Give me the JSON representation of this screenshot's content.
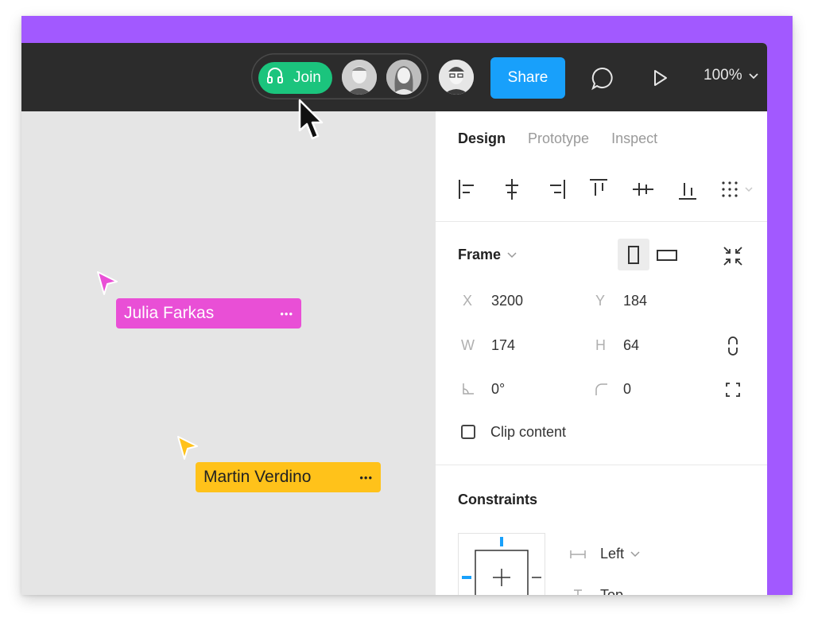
{
  "topbar": {
    "join_label": "Join",
    "share_label": "Share",
    "zoom_label": "100%",
    "icons": [
      "headphones-icon",
      "comment-icon",
      "play-icon",
      "chevron-down-icon"
    ]
  },
  "collaborators": [
    {
      "name": "Julia Farkas",
      "color": "#e94fd6",
      "text_color": "#ffffff"
    },
    {
      "name": "Martin Verdino",
      "color": "#ffc21a",
      "text_color": "#222222"
    }
  ],
  "more_glyph": "•••",
  "design_panel": {
    "tabs": [
      "Design",
      "Prototype",
      "Inspect"
    ],
    "frame": {
      "title": "Frame",
      "x_label": "X",
      "x_value": "3200",
      "y_label": "Y",
      "y_value": "184",
      "w_label": "W",
      "w_value": "174",
      "h_label": "H",
      "h_value": "64",
      "rotation_value": "0°",
      "radius_value": "0",
      "clip_content_label": "Clip content"
    },
    "constraints": {
      "title": "Constraints",
      "horizontal_value": "Left",
      "vertical_value": "Top"
    }
  },
  "colors": {
    "accent_purple": "#a259ff",
    "join_green": "#1bc47d",
    "share_blue": "#18a0fb",
    "topbar": "#2c2c2c"
  }
}
